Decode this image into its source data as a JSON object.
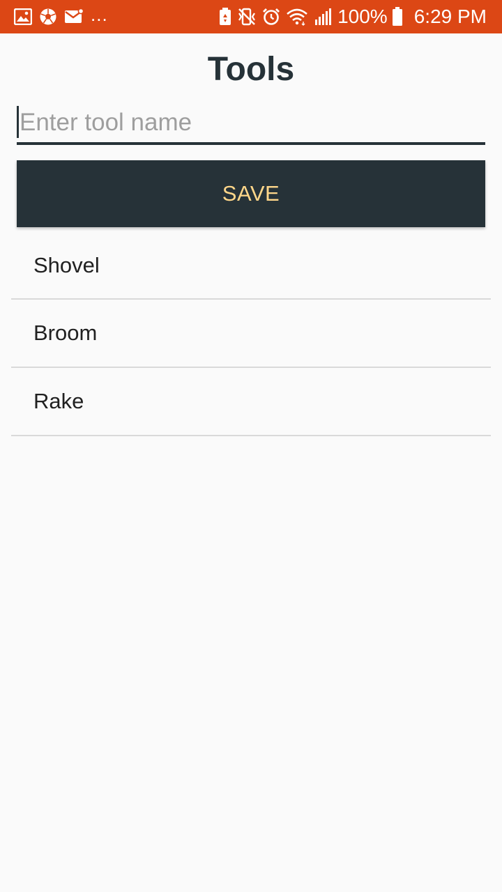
{
  "status_bar": {
    "left_icons": [
      "gallery-icon",
      "soccer-ball-icon",
      "mail-icon"
    ],
    "overflow": "...",
    "right_icons": [
      "battery-saver-icon",
      "mute-icon",
      "alarm-icon",
      "wifi-icon",
      "signal-icon"
    ],
    "battery_percent": "100%",
    "time": "6:29 PM",
    "background_color": "#dc4715"
  },
  "header": {
    "title": "Tools"
  },
  "form": {
    "input_placeholder": "Enter tool name",
    "input_value": "",
    "save_label": "SAVE"
  },
  "tools": [
    {
      "name": "Shovel"
    },
    {
      "name": "Broom"
    },
    {
      "name": "Rake"
    }
  ],
  "colors": {
    "accent_dark": "#263238",
    "save_text": "#ffd78a",
    "background": "#fafafa"
  }
}
